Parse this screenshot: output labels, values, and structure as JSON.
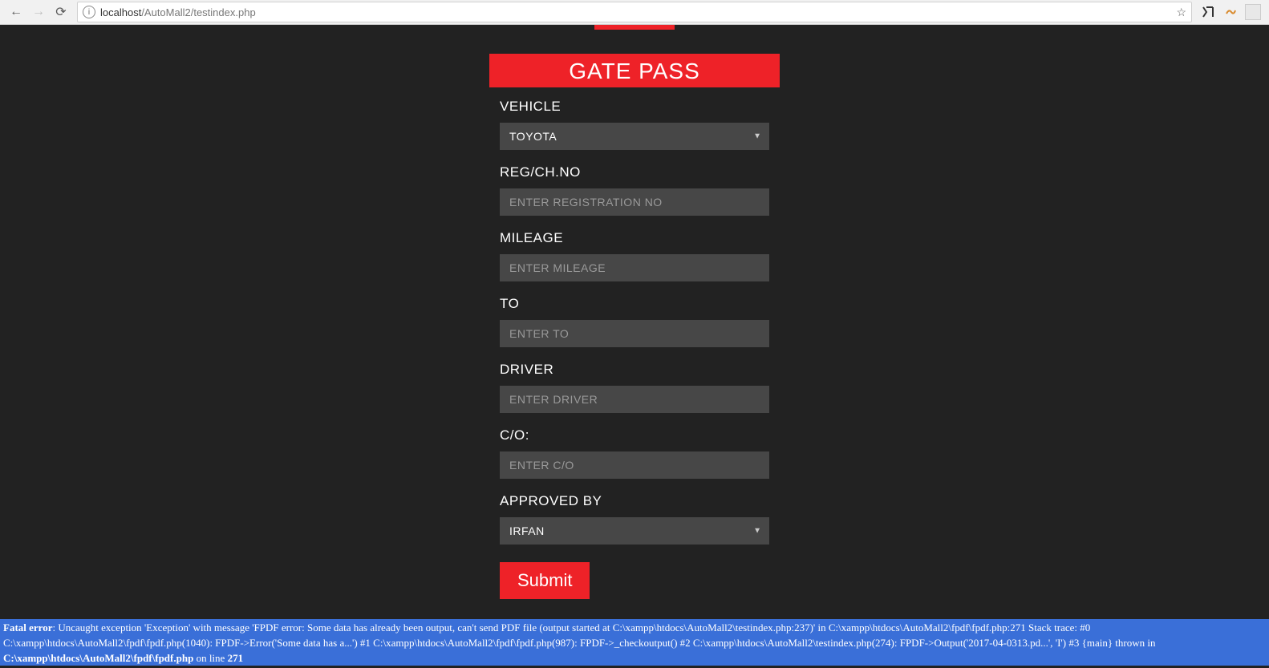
{
  "browser": {
    "url_host": "localhost",
    "url_path": "/AutoMall2/testindex.php"
  },
  "form": {
    "title": "Gate Pass",
    "vehicle": {
      "label": "Vehicle",
      "value": "Toyota"
    },
    "reg": {
      "label": "Reg/Ch.No",
      "placeholder": "Enter Registration No"
    },
    "mileage": {
      "label": "Mileage",
      "placeholder": "Enter Mileage"
    },
    "to": {
      "label": "To",
      "placeholder": "Enter To"
    },
    "driver": {
      "label": "Driver",
      "placeholder": "Enter Driver"
    },
    "co": {
      "label": "C/O:",
      "placeholder": "Enter C/O"
    },
    "approved": {
      "label": "Approved By",
      "value": "Irfan"
    },
    "submit": "Submit"
  },
  "error": {
    "prefix": "Fatal error",
    "part1": ": Uncaught exception 'Exception' with message 'FPDF error: Some data has already been output, can't send PDF file (output started at C:\\xampp\\htdocs\\AutoMall2\\testindex.php:237)' in C:\\xampp\\htdocs\\AutoMall2\\fpdf\\fpdf.php:271 Stack trace: #0 C:\\xampp\\htdocs\\AutoMall2\\fpdf\\fpdf.php(1040): FPDF->Error('Some data has a...') #1 C:\\xampp\\htdocs\\AutoMall2\\fpdf\\fpdf.php(987): FPDF->_checkoutput() #2 C:\\xampp\\htdocs\\AutoMall2\\testindex.php(274): FPDF->Output('2017-04-0313.pd...', 'I') #3 {main} thrown in ",
    "file": "C:\\xampp\\htdocs\\AutoMall2\\fpdf\\fpdf.php",
    "online": " on line ",
    "line": "271"
  }
}
